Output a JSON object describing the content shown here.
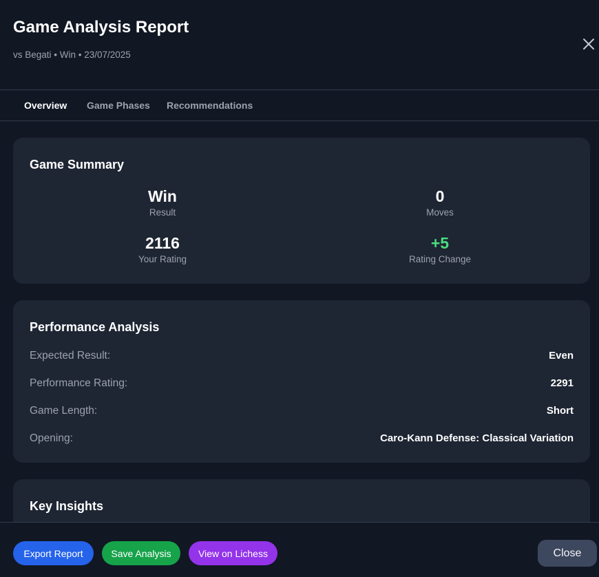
{
  "header": {
    "title": "Game Analysis Report",
    "subtitle": "vs Begati • Win • 23/07/2025",
    "close_icon": "close-icon"
  },
  "tabs": [
    {
      "label": "Overview",
      "active": true
    },
    {
      "label": "Game Phases",
      "active": false
    },
    {
      "label": "Recommendations",
      "active": false
    }
  ],
  "summary": {
    "title": "Game Summary",
    "stats": [
      {
        "value": "Win",
        "label": "Result"
      },
      {
        "value": "0",
        "label": "Moves"
      },
      {
        "value": "2116",
        "label": "Your Rating"
      },
      {
        "value": "+5",
        "label": "Rating Change"
      }
    ]
  },
  "performance": {
    "title": "Performance Analysis",
    "rows": [
      {
        "label": "Expected Result:",
        "value": "Even"
      },
      {
        "label": "Performance Rating:",
        "value": "2291"
      },
      {
        "label": "Game Length:",
        "value": "Short"
      },
      {
        "label": "Opening:",
        "value": "Caro-Kann Defense: Classical Variation"
      }
    ]
  },
  "insights": {
    "title": "Key Insights"
  },
  "footer": {
    "export_label": "Export Report",
    "save_label": "Save Analysis",
    "lichess_label": "View on Lichess",
    "close_label": "Close"
  },
  "colors": {
    "background": "#111723",
    "card": "#1e2533",
    "positive": "#4ade80",
    "export": "#2563eb",
    "save": "#16a34a",
    "lichess": "#9333ea",
    "close": "#3d475e"
  }
}
